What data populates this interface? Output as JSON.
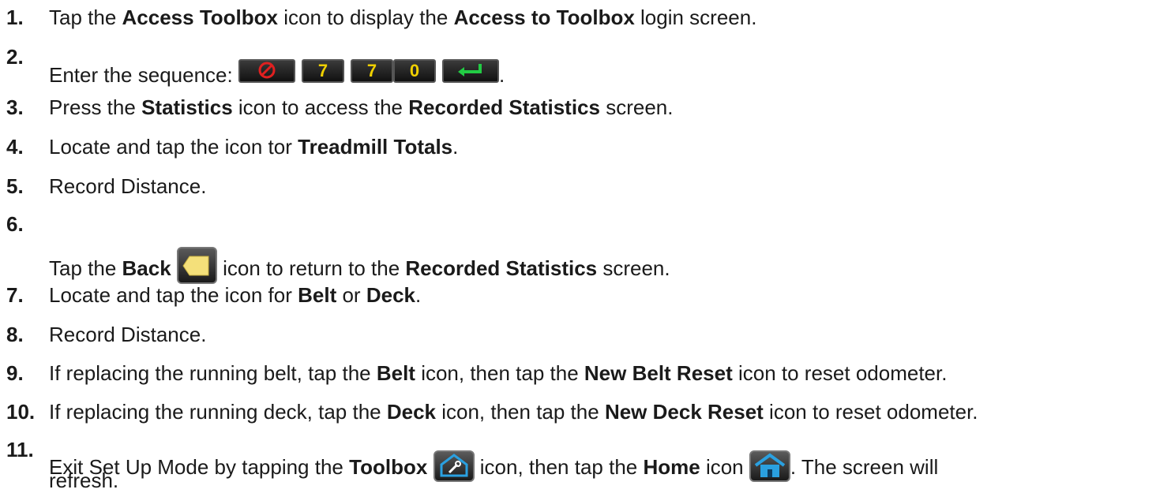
{
  "steps": [
    {
      "n": "1.",
      "parts": [
        "Tap the ",
        "Access Toolbox",
        " icon to display the ",
        "Access to Toolbox",
        " login screen."
      ]
    },
    {
      "n": "2.",
      "pre": "Enter the sequence: ",
      "post": ".",
      "keys": [
        {
          "label": "",
          "icon": "no-entry-icon"
        },
        {
          "label": "7"
        },
        {
          "label": "7"
        },
        {
          "label": "0"
        },
        {
          "label": "",
          "icon": "enter-arrow-icon"
        }
      ]
    },
    {
      "n": "3.",
      "parts": [
        "Press the ",
        "Statistics",
        " icon to access the ",
        "Recorded Statistics",
        " screen."
      ]
    },
    {
      "n": "4.",
      "parts": [
        "Locate and tap the icon tor ",
        "Treadmill Totals",
        "."
      ]
    },
    {
      "n": "5.",
      "text": "Record Distance."
    },
    {
      "n": "6.",
      "parts": [
        "Tap the ",
        "Back",
        " icon to return to the ",
        "Recorded Statistics",
        " screen."
      ]
    },
    {
      "n": "7.",
      "parts": [
        "Locate and tap the icon for ",
        "Belt",
        " or ",
        "Deck",
        "."
      ]
    },
    {
      "n": "8.",
      "text": "Record Distance."
    },
    {
      "n": "9.",
      "parts": [
        "If replacing the running belt, tap the ",
        "Belt",
        " icon, then tap the ",
        "New Belt Reset",
        " icon to reset odometer."
      ]
    },
    {
      "n": "10.",
      "parts": [
        "If replacing the running deck, tap the ",
        "Deck",
        " icon, then tap the ",
        "New Deck Reset",
        " icon to reset odometer."
      ]
    },
    {
      "n": "11.",
      "parts": [
        "Exit Set Up Mode by tapping the ",
        "Toolbox",
        " icon, then tap the ",
        "Home",
        " icon",
        ". The screen will"
      ],
      "cont": "refresh."
    }
  ],
  "colors": {
    "key_text": "#f0d000",
    "enter_green": "#22cc44",
    "clear_red": "#e02020",
    "back_yellow": "#f4e07a",
    "toolbox_blue": "#2aa0e0"
  }
}
